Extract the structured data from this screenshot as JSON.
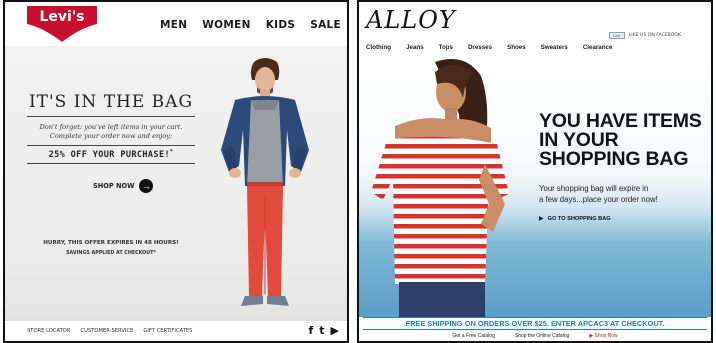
{
  "levis": {
    "logo_text": "Levi's",
    "nav": [
      "MEN",
      "WOMEN",
      "KIDS",
      "SALE"
    ],
    "headline": "IT'S IN THE BAG",
    "subtext_line1": "Don't forget: you've left items in your cart.",
    "subtext_line2": "Complete your order now and enjoy:",
    "offer": "25% OFF YOUR PURCHASE!",
    "offer_mark": "*",
    "shop_now": "SHOP NOW",
    "shop_arrow": "→",
    "hurry": "HURRY, THIS OFFER EXPIRES IN 48 HOURS!",
    "savings": "SAVINGS APPLIED AT CHECKOUT*",
    "footer_links": [
      "STORE LOCATOR",
      "CUSTOMER SERVICE",
      "GIFT CERTIFICATES"
    ],
    "social_icons": [
      "facebook-icon",
      "twitter-icon",
      "youtube-icon"
    ],
    "social_glyphs": [
      "f",
      "t",
      "▶"
    ],
    "colors": {
      "logo_red": "#c8102e",
      "hero_bg": "#efefef",
      "jeans": "#e24a3b",
      "jacket": "#2b4a7a"
    }
  },
  "alloy": {
    "logo": "ALLOY",
    "like_button": "Like",
    "like_text": "LIKE US ON FACEBOOK",
    "nav": [
      "Clothing",
      "Jeans",
      "Tops",
      "Dresses",
      "Shoes",
      "Sweaters",
      "Clearance"
    ],
    "headline_line1": "YOU HAVE ITEMS",
    "headline_line2": "IN YOUR",
    "headline_line3": "SHOPPING BAG",
    "body_line1": "Your shopping bag will expire in",
    "body_line2": "a few days...place your order now!",
    "goto_arrow": "▶",
    "goto_label": "GO TO SHOPPING BAG",
    "banner": "FREE SHIPPING ON ORDERS OVER $25. ENTER APCAC3 AT CHECKOUT.",
    "footer_links": [
      "Get a Free Catalog",
      "Shop the Online Catalog"
    ],
    "shop_now": "▶ Shop Now",
    "colors": {
      "banner_blue": "#1c7cc7",
      "stripe_red": "#d9322e",
      "sea": "#5a9fc5"
    }
  }
}
